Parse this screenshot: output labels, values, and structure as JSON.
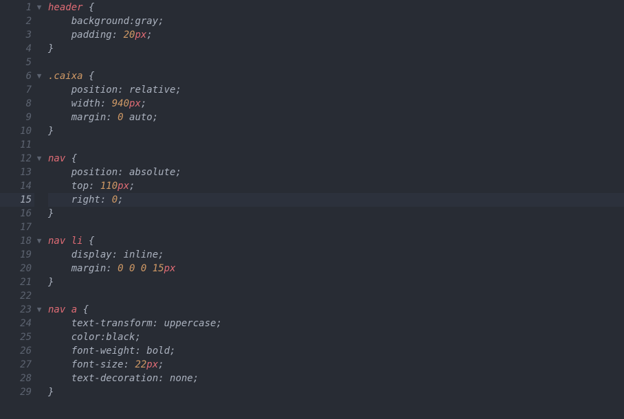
{
  "gutter": {
    "lines": [
      "1",
      "2",
      "3",
      "4",
      "5",
      "6",
      "7",
      "8",
      "9",
      "10",
      "11",
      "12",
      "13",
      "14",
      "15",
      "16",
      "17",
      "18",
      "19",
      "20",
      "21",
      "22",
      "23",
      "24",
      "25",
      "26",
      "27",
      "28",
      "29"
    ],
    "fold_marker": "▼",
    "fold_lines": [
      1,
      6,
      12,
      18,
      23
    ],
    "current_line": 15
  },
  "code": {
    "r1": {
      "sel": "header",
      "brace": " {"
    },
    "r2": {
      "prop": "background",
      "colon": ":",
      "val": "gray",
      "semi": ";"
    },
    "r3": {
      "prop": "padding",
      "colon": ": ",
      "num": "20",
      "unit": "px",
      "semi": ";"
    },
    "r4": {
      "brace": "}"
    },
    "r6": {
      "sel": ".caixa",
      "brace": " {"
    },
    "r7": {
      "prop": "position",
      "colon": ": ",
      "val": "relative",
      "semi": ";"
    },
    "r8": {
      "prop": "width",
      "colon": ": ",
      "num": "940",
      "unit": "px",
      "semi": ";"
    },
    "r9": {
      "prop": "margin",
      "colon": ": ",
      "num": "0",
      "val": " auto",
      "semi": ";"
    },
    "r10": {
      "brace": "}"
    },
    "r12": {
      "sel": "nav",
      "brace": " {"
    },
    "r13": {
      "prop": "position",
      "colon": ": ",
      "val": "absolute",
      "semi": ";"
    },
    "r14": {
      "prop": "top",
      "colon": ": ",
      "num": "110",
      "unit": "px",
      "semi": ";"
    },
    "r15": {
      "prop": "right",
      "colon": ": ",
      "num": "0",
      "semi": ";"
    },
    "r16": {
      "brace": "}"
    },
    "r18": {
      "sel1": "nav",
      "sp": " ",
      "sel2": "li",
      "brace": " {"
    },
    "r19": {
      "prop": "display",
      "colon": ": ",
      "val": "inline",
      "semi": ";"
    },
    "r20": {
      "prop": "margin",
      "colon": ": ",
      "n1": "0",
      "sp1": " ",
      "n2": "0",
      "sp2": " ",
      "n3": "0",
      "sp3": " ",
      "n4": "15",
      "unit": "px"
    },
    "r21": {
      "brace": "}"
    },
    "r23": {
      "sel1": "nav",
      "sp": " ",
      "sel2": "a",
      "brace": " {"
    },
    "r24": {
      "prop": "text-transform",
      "colon": ": ",
      "val": "uppercase",
      "semi": ";"
    },
    "r25": {
      "prop": "color",
      "colon": ":",
      "val": "black",
      "semi": ";"
    },
    "r26": {
      "prop": "font-weight",
      "colon": ": ",
      "val": "bold",
      "semi": ";"
    },
    "r27": {
      "prop": "font-size",
      "colon": ": ",
      "num": "22",
      "unit": "px",
      "semi": ";"
    },
    "r28": {
      "prop": "text-decoration",
      "colon": ": ",
      "val": "none",
      "semi": ";"
    },
    "r29": {
      "brace": "}"
    }
  }
}
